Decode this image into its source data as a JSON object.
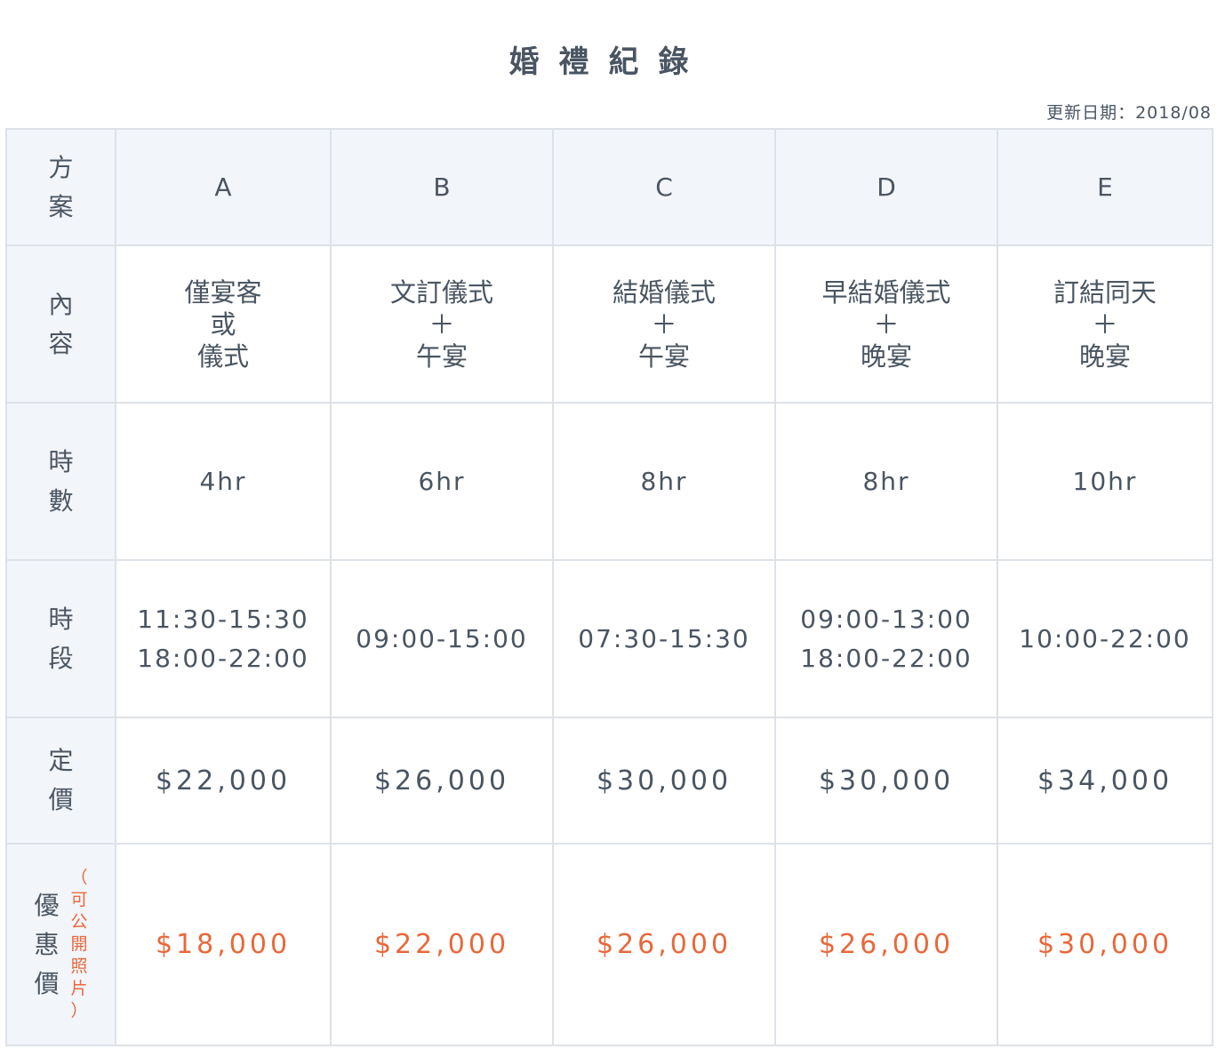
{
  "title": "婚禮紀錄",
  "updated": "更新日期：2018/08",
  "table": {
    "header_label": [
      "方",
      "案"
    ],
    "plans": [
      "A",
      "B",
      "C",
      "D",
      "E"
    ],
    "content_label": [
      "內",
      "容"
    ],
    "content": [
      [
        "僅宴客",
        "或",
        "儀式"
      ],
      [
        "文訂儀式",
        "＋",
        "午宴"
      ],
      [
        "結婚儀式",
        "＋",
        "午宴"
      ],
      [
        "早結婚儀式",
        "＋",
        "晚宴"
      ],
      [
        "訂結同天",
        "＋",
        "晚宴"
      ]
    ],
    "hours_label": [
      "時",
      "數"
    ],
    "hours": [
      "4hr",
      "6hr",
      "8hr",
      "8hr",
      "10hr"
    ],
    "time_label": [
      "時",
      "段"
    ],
    "times": [
      [
        "11:30-15:30",
        "18:00-22:00"
      ],
      [
        "09:00-15:00"
      ],
      [
        "07:30-15:30"
      ],
      [
        "09:00-13:00",
        "18:00-22:00"
      ],
      [
        "10:00-22:00"
      ]
    ],
    "price_label": [
      "定",
      "價"
    ],
    "prices": [
      "$22,000",
      "$26,000",
      "$30,000",
      "$30,000",
      "$34,000"
    ],
    "promo_label": [
      "優",
      "惠",
      "價"
    ],
    "promo_note": [
      "（",
      "可",
      "公",
      "開",
      "照",
      "片",
      "）"
    ],
    "promo_prices": [
      "$18,000",
      "$22,000",
      "$26,000",
      "$26,000",
      "$30,000"
    ]
  },
  "colors": {
    "text": "#4a5562",
    "accent": "#e8683a",
    "label_bg": "#f2f5fa",
    "border": "#dde2e8"
  }
}
